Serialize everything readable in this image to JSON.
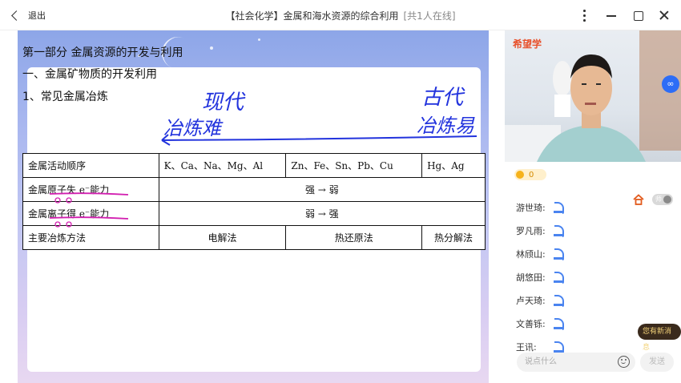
{
  "titlebar": {
    "back_label": "退出",
    "title": "【社会化学】金属和海水资源的综合利用",
    "online": "[共1人在线]"
  },
  "slide": {
    "heading1": "第一部分 金属资源的开发与利用",
    "heading2": "一、金属矿物质的开发利用",
    "heading3": "1、常见金属冶炼",
    "table": {
      "row1": [
        "金属活动顺序",
        "K、Ca、Na、Mg、Al",
        "Zn、Fe、Sn、Pb、Cu",
        "Hg、Ag"
      ],
      "row2": [
        "金属原子失 e⁻能力",
        "强  →  弱"
      ],
      "row3": [
        "金属离子得 e⁻能力",
        "弱  →  强"
      ],
      "row4": [
        "主要冶炼方法",
        "电解法",
        "热还原法",
        "热分解法"
      ]
    },
    "handwriting": {
      "modern": "现代",
      "ancient": "古代",
      "hard": "冶炼难",
      "easy": "冶炼易",
      "ink_color": "#2233dd",
      "underline_color": "#d21fb0"
    }
  },
  "side": {
    "brand": "希望学",
    "coins": "0",
    "students": [
      "游世琦:",
      "罗凡雨:",
      "林颀山:",
      "胡悠田:",
      "卢天琦:",
      "文善铄:",
      "王讯:"
    ],
    "toggle_label": "师",
    "new_msg": "您有新消息",
    "chat_placeholder": "说点什么",
    "send_label": "发送"
  }
}
